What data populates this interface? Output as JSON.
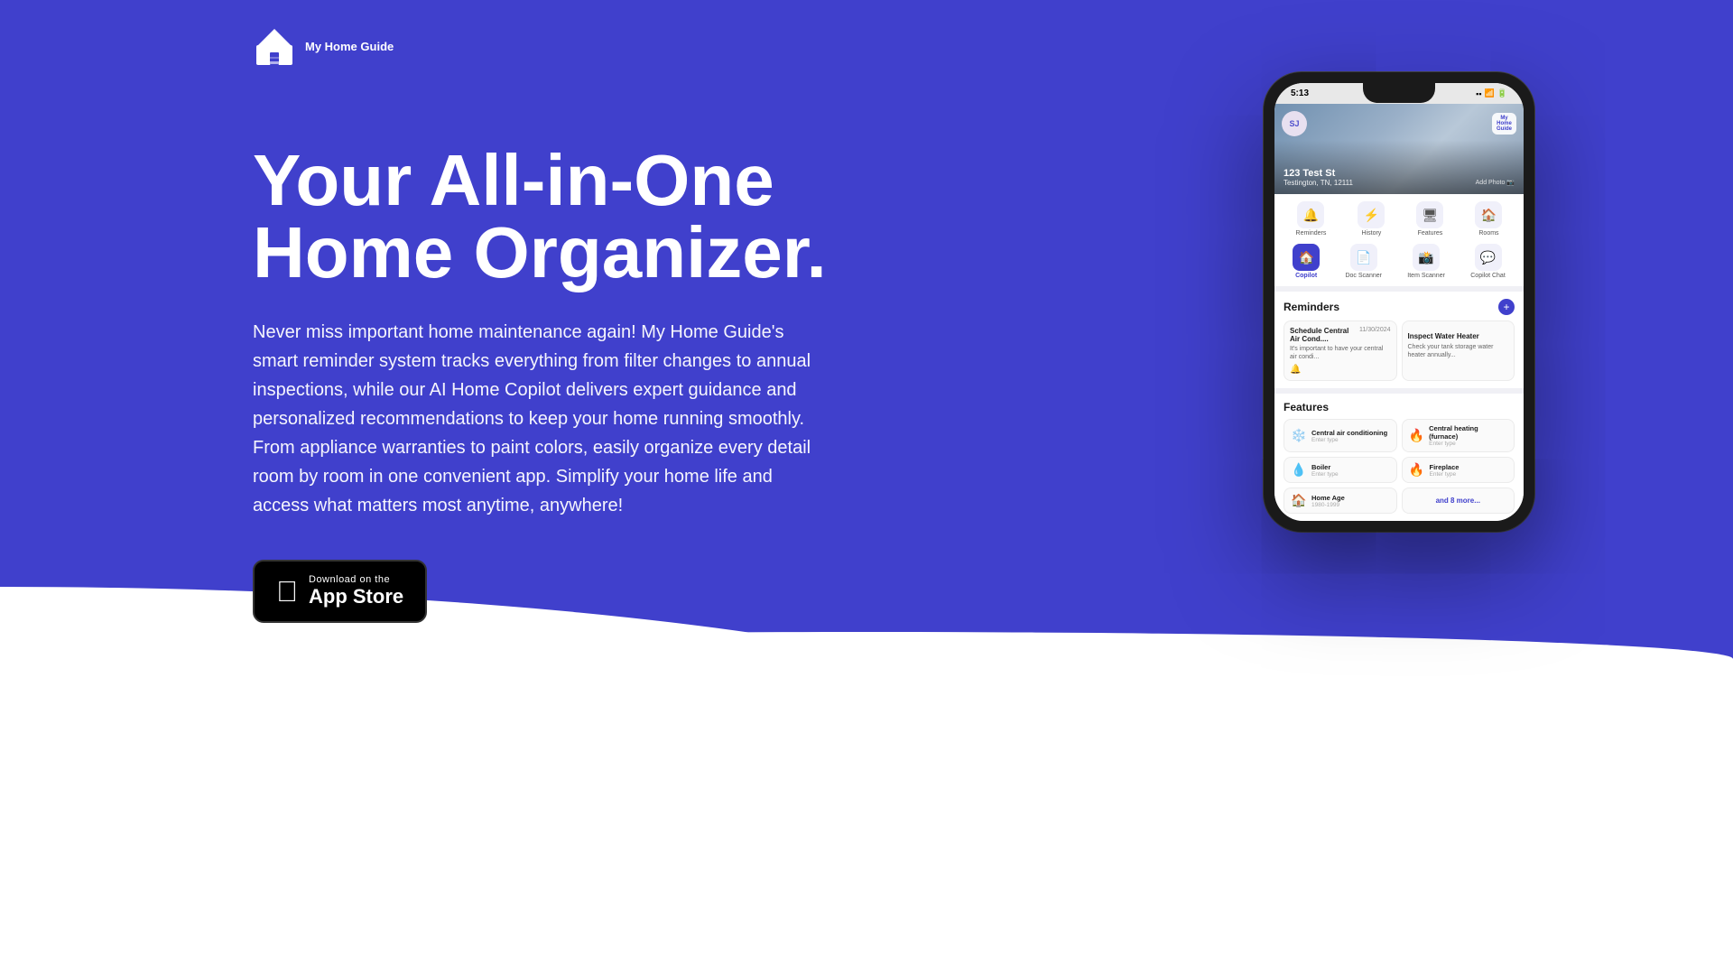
{
  "brand": {
    "name": "My Home Guide",
    "logo_alt": "My Home Guide logo"
  },
  "hero": {
    "title": "Your All-in-One Home Organizer.",
    "description": "Never miss important home maintenance again! My Home Guide's smart reminder system tracks everything from filter changes to annual inspections, while our AI Home Copilot delivers expert guidance and personalized recommendations to keep your home running smoothly. From appliance warranties to paint colors, easily organize every detail room by room in one convenient app. Simplify your home life and access what matters most anytime, anywhere!",
    "app_store": {
      "download_on": "Download on the",
      "store_name": "App Store"
    }
  },
  "phone": {
    "status_bar": {
      "time": "5:13",
      "icons": "●● ▶ 🔋"
    },
    "home_header": {
      "avatar_initials": "SJ",
      "address_street": "123 Test St",
      "address_city": "Testington, TN, 12111",
      "add_photo": "Add Photo 📷"
    },
    "nav_row1": [
      {
        "label": "Reminders",
        "icon": "🔔"
      },
      {
        "label": "History",
        "icon": "⚡"
      },
      {
        "label": "Features",
        "icon": "🖥"
      },
      {
        "label": "Rooms",
        "icon": "🏠"
      }
    ],
    "nav_row2": [
      {
        "label": "Copilot",
        "icon": "🏠",
        "active": true
      },
      {
        "label": "Doc Scanner",
        "icon": "📄"
      },
      {
        "label": "Item Scanner",
        "icon": "📸"
      },
      {
        "label": "Copilot Chat",
        "icon": "💬"
      }
    ],
    "reminders": {
      "section_title": "Reminders",
      "add_btn": "+",
      "items": [
        {
          "title": "Schedule Central Air Cond....",
          "date": "11/30/2024",
          "desc": "It's important to have your central air condi..."
        },
        {
          "title": "Inspect Water Heater",
          "desc": "Check your tank storage water heater annually..."
        }
      ]
    },
    "features": {
      "section_title": "Features",
      "items": [
        {
          "icon": "❄️",
          "name": "Central air conditioning",
          "sub": "Enter type"
        },
        {
          "icon": "🔥",
          "name": "Central heating (furnace)",
          "sub": "Enter type"
        },
        {
          "icon": "💧",
          "name": "Boiler",
          "sub": "Enter type"
        },
        {
          "icon": "🔥",
          "name": "Fireplace",
          "sub": "Enter type"
        },
        {
          "icon": "🏠",
          "name": "Home Age",
          "sub": "1980-1999"
        }
      ],
      "more_label": "and 8 more..."
    }
  },
  "colors": {
    "brand_blue": "#4040cc",
    "white": "#ffffff",
    "black": "#000000",
    "text_dark": "#1a1a1a",
    "text_gray": "#666666"
  }
}
